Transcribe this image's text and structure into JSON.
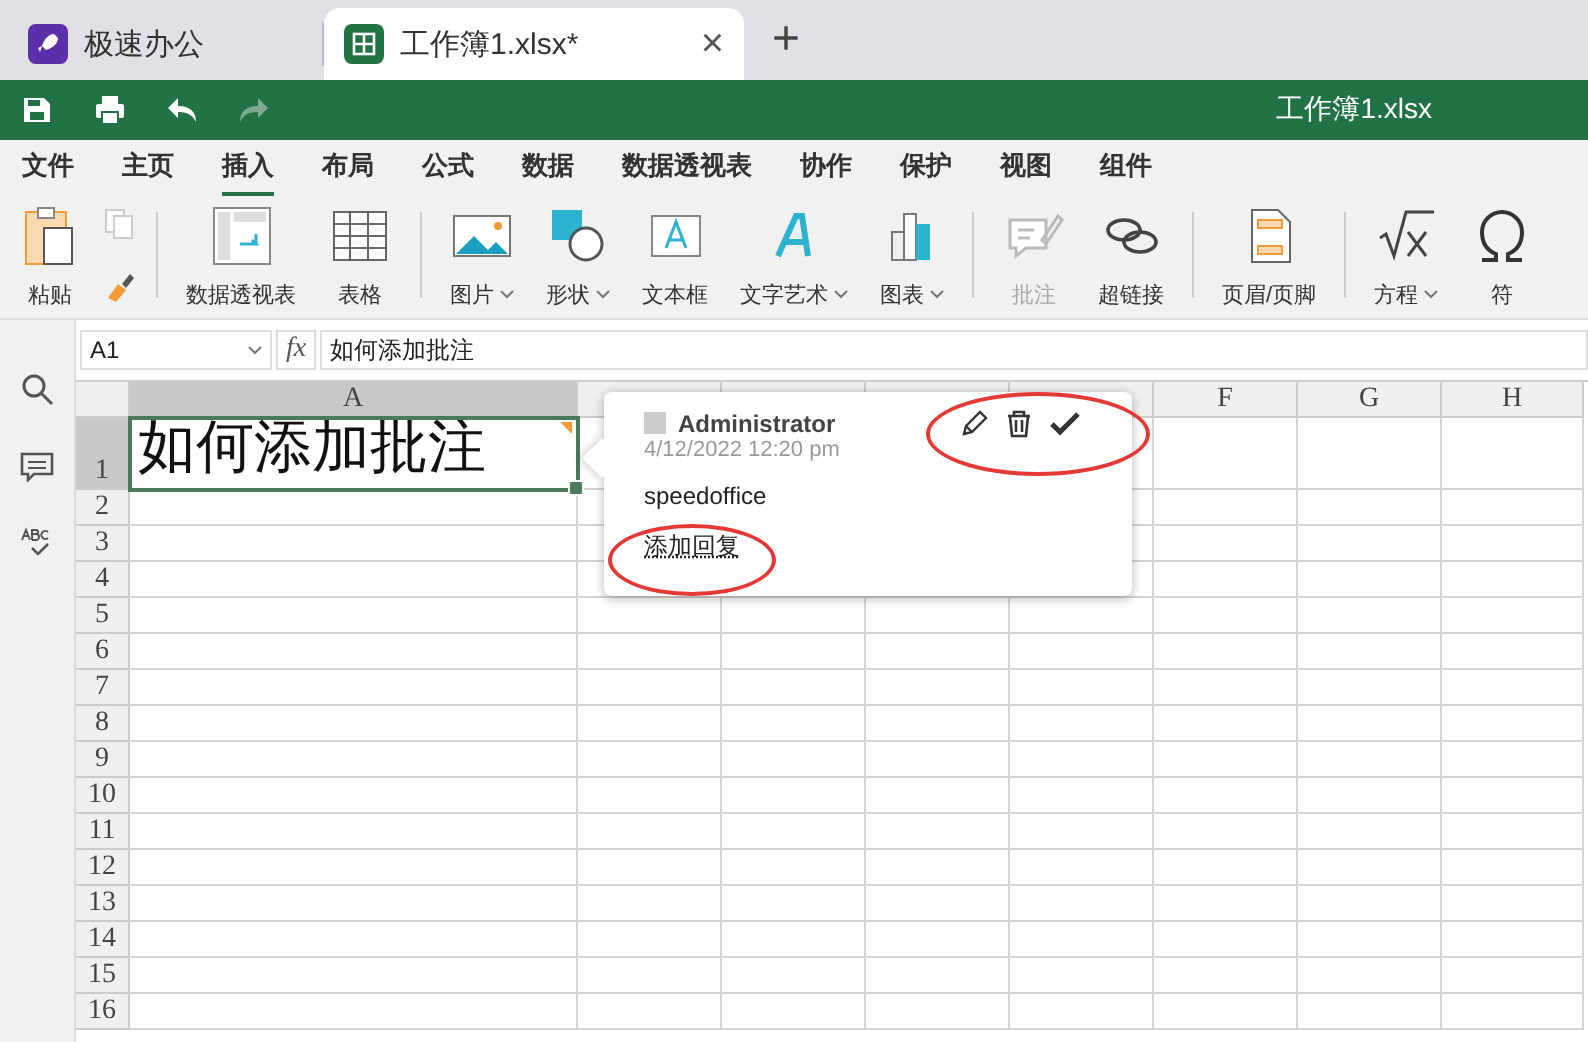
{
  "tabs": [
    {
      "label": "极速办公",
      "selected": false
    },
    {
      "label": "工作簿1.xlsx*",
      "selected": true,
      "close": "×"
    }
  ],
  "new_tab_button": "+",
  "quick_access": {
    "title": "工作簿1.xlsx",
    "redo_disabled": true
  },
  "menu": [
    {
      "label": "文件",
      "selected": false
    },
    {
      "label": "主页",
      "selected": false
    },
    {
      "label": "插入",
      "selected": true
    },
    {
      "label": "布局",
      "selected": false
    },
    {
      "label": "公式",
      "selected": false
    },
    {
      "label": "数据",
      "selected": false
    },
    {
      "label": "数据透视表",
      "selected": false
    },
    {
      "label": "协作",
      "selected": false
    },
    {
      "label": "保护",
      "selected": false
    },
    {
      "label": "视图",
      "selected": false
    },
    {
      "label": "组件",
      "selected": false
    }
  ],
  "ribbon": {
    "paste": {
      "label": "粘贴",
      "copy_disabled": true
    },
    "groups": [
      [
        {
          "label": "数据透视表",
          "dropdown": false,
          "disabled": false
        },
        {
          "label": "表格",
          "dropdown": false,
          "disabled": false
        }
      ],
      [
        {
          "label": "图片",
          "dropdown": true,
          "disabled": false
        },
        {
          "label": "形状",
          "dropdown": true,
          "disabled": false
        },
        {
          "label": "文本框",
          "dropdown": false,
          "disabled": false
        },
        {
          "label": "文字艺术",
          "dropdown": true,
          "disabled": false
        },
        {
          "label": "图表",
          "dropdown": true,
          "disabled": false
        }
      ],
      [
        {
          "label": "批注",
          "dropdown": false,
          "disabled": true
        },
        {
          "label": "超链接",
          "dropdown": false,
          "disabled": false
        }
      ],
      [
        {
          "label": "页眉/页脚",
          "dropdown": false,
          "disabled": false
        }
      ],
      [
        {
          "label": "方程",
          "dropdown": true,
          "disabled": false
        },
        {
          "label": "符",
          "dropdown": false,
          "disabled": false
        }
      ]
    ]
  },
  "formula_bar": {
    "name_box": "A1",
    "fx": "fx",
    "value": "如何添加批注"
  },
  "sheet": {
    "columns": [
      {
        "label": "A",
        "selected": true
      },
      {
        "label": "F",
        "selected": false
      },
      {
        "label": "G",
        "selected": false
      },
      {
        "label": "H",
        "selected": false
      }
    ],
    "rows": [
      {
        "label": "1",
        "selected": true
      },
      {
        "label": "2",
        "selected": false
      },
      {
        "label": "3",
        "selected": false
      },
      {
        "label": "4",
        "selected": false
      },
      {
        "label": "5",
        "selected": false
      },
      {
        "label": "6",
        "selected": false
      },
      {
        "label": "7",
        "selected": false
      },
      {
        "label": "8",
        "selected": false
      },
      {
        "label": "9",
        "selected": false
      },
      {
        "label": "10",
        "selected": false
      },
      {
        "label": "11",
        "selected": false
      },
      {
        "label": "12",
        "selected": false
      },
      {
        "label": "13",
        "selected": false
      },
      {
        "label": "14",
        "selected": false
      },
      {
        "label": "15",
        "selected": false
      },
      {
        "label": "16",
        "selected": false
      }
    ],
    "cell_a1": {
      "value": "如何添加批注",
      "selected": true,
      "has_comment": true
    }
  },
  "comment": {
    "author": "Administrator",
    "date": "4/12/2022 12:20 pm",
    "text": "speedoffice",
    "reply_link": "添加回复"
  }
}
